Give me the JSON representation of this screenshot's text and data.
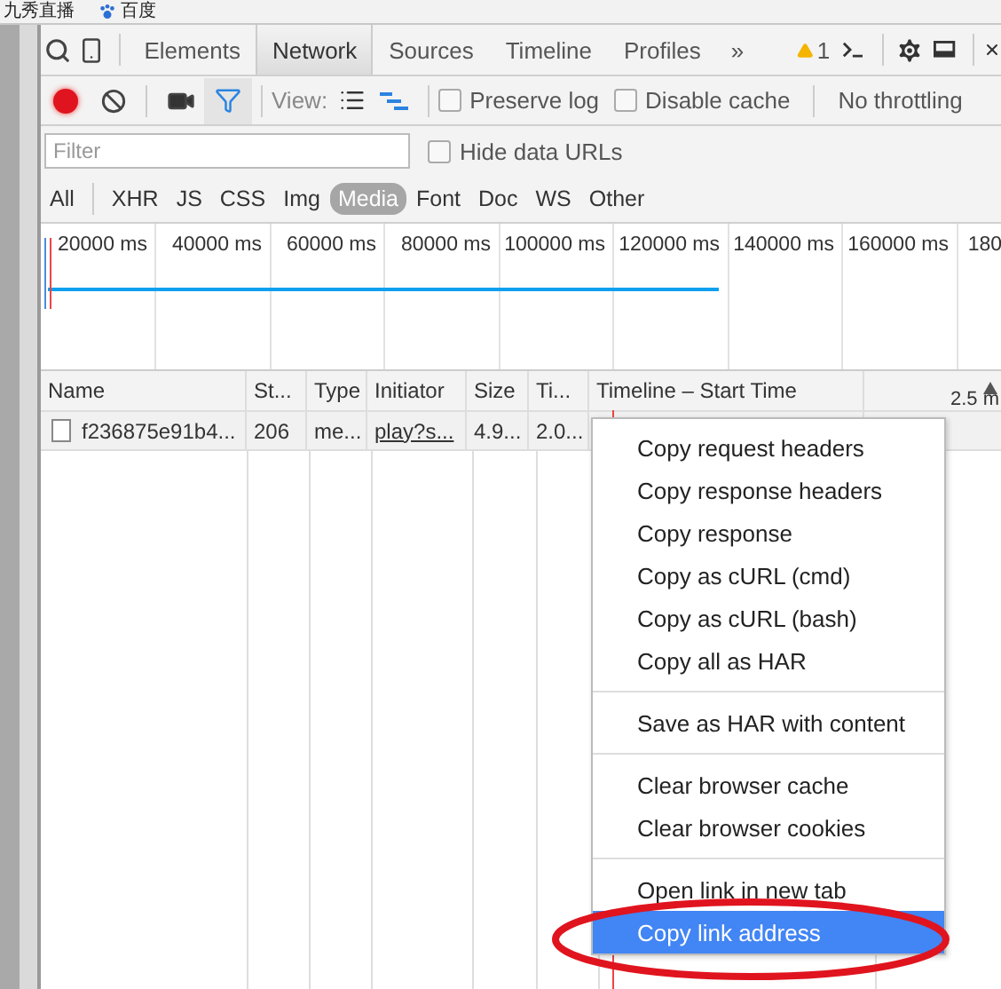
{
  "bookmarks": [
    {
      "label": "九秀直播",
      "kind": "text"
    },
    {
      "label": "百度",
      "kind": "paw"
    }
  ],
  "tabs": [
    {
      "label": "Elements",
      "selected": false
    },
    {
      "label": "Network",
      "selected": true
    },
    {
      "label": "Sources",
      "selected": false
    },
    {
      "label": "Timeline",
      "selected": false
    },
    {
      "label": "Profiles",
      "selected": false
    }
  ],
  "more_tabs": "»",
  "warnings": "1",
  "toolbar": {
    "recording": true,
    "filter_on": true,
    "view_label": "View:",
    "list_view_selected": false,
    "waterfall_view_selected": true,
    "preserve_log": {
      "label": "Preserve log",
      "checked": false
    },
    "disable_cache": {
      "label": "Disable cache",
      "checked": false
    },
    "throttling": "No throttling"
  },
  "filter": {
    "placeholder": "Filter",
    "hide_data_urls": {
      "label": "Hide data URLs",
      "checked": false
    }
  },
  "type_filters": [
    {
      "label": "All",
      "selected": false
    },
    {
      "label": "XHR",
      "selected": false
    },
    {
      "label": "JS",
      "selected": false
    },
    {
      "label": "CSS",
      "selected": false
    },
    {
      "label": "Img",
      "selected": false
    },
    {
      "label": "Media",
      "selected": true
    },
    {
      "label": "Font",
      "selected": false
    },
    {
      "label": "Doc",
      "selected": false
    },
    {
      "label": "WS",
      "selected": false
    },
    {
      "label": "Other",
      "selected": false
    }
  ],
  "overview_ticks": [
    "20000 ms",
    "40000 ms",
    "60000 ms",
    "80000 ms",
    "100000 ms",
    "120000 ms",
    "140000 ms",
    "160000 ms",
    "180"
  ],
  "table": {
    "columns": [
      "Name",
      "St...",
      "Type",
      "Initiator",
      "Size",
      "Ti...",
      "Timeline – Start Time"
    ],
    "sort_reading": "2.5 m",
    "rows": [
      {
        "cells": [
          "f236875e91b4...",
          "206",
          "me...",
          "play?s...",
          "4.9...",
          "2.0..."
        ]
      }
    ]
  },
  "context_menu": [
    {
      "kind": "item",
      "label": "Copy request headers",
      "selected": false
    },
    {
      "kind": "item",
      "label": "Copy response headers",
      "selected": false
    },
    {
      "kind": "item",
      "label": "Copy response",
      "selected": false
    },
    {
      "kind": "item",
      "label": "Copy as cURL (cmd)",
      "selected": false
    },
    {
      "kind": "item",
      "label": "Copy as cURL (bash)",
      "selected": false
    },
    {
      "kind": "item",
      "label": "Copy all as HAR",
      "selected": false
    },
    {
      "kind": "separator"
    },
    {
      "kind": "item",
      "label": "Save as HAR with content",
      "selected": false
    },
    {
      "kind": "separator"
    },
    {
      "kind": "item",
      "label": "Clear browser cache",
      "selected": false
    },
    {
      "kind": "item",
      "label": "Clear browser cookies",
      "selected": false
    },
    {
      "kind": "separator"
    },
    {
      "kind": "item",
      "label": "Open link in new tab",
      "selected": false
    },
    {
      "kind": "item",
      "label": "Copy link address",
      "selected": true
    }
  ]
}
